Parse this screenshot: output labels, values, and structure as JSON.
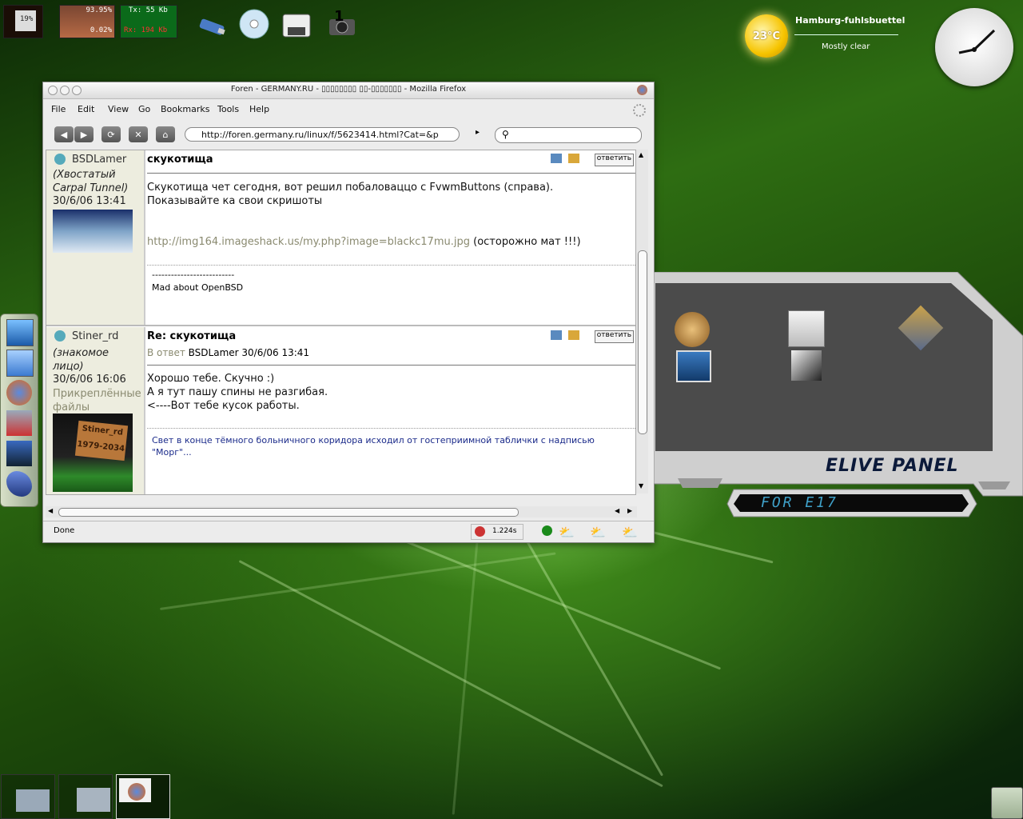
{
  "desktop": {
    "monitors": {
      "cpu_percent": "19%",
      "mem_top": "93.95%",
      "mem_bottom": "0.02%",
      "net_tx": "Tx: 55 Kb",
      "net_rx": "Rx: 194 Kb"
    },
    "icons": [
      "usb-drive-icon",
      "cd-icon",
      "floppy-icon",
      "camera-icon"
    ],
    "camera_badge": "1",
    "weather": {
      "temp": "23°C",
      "city": "Hamburg-fuhlsbuettel",
      "condition": "Mostly clear"
    }
  },
  "browser": {
    "title": "Foren - GERMANY.RU - ▯▯▯▯▯▯▯▯ ▯▯-▯▯▯▯▯▯▯ - Mozilla Firefox",
    "menu": [
      "File",
      "Edit",
      "View",
      "Go",
      "Bookmarks",
      "Tools",
      "Help"
    ],
    "url": "http://foren.germany.ru/linux/f/5623414.html?Cat=&p",
    "search_placeholder": "",
    "status": "Done",
    "load_time": "1.224s",
    "reply_label": "ответить",
    "posts": [
      {
        "author": "BSDLamer",
        "status": "(Хвостатый Carpal Tunnel)",
        "date": "30/6/06 13:41",
        "subject": "скукотища",
        "body": [
          "Скукотища чет сегодня, вот решил побаловаццо с FvwmButtons (справа).",
          "Показывайте ка свои скришоты"
        ],
        "link": "http://img164.imageshack.us/my.php?image=blackc17mu.jpg",
        "link_suffix": "(осторожно мат !!!)",
        "signature_rule": "--------------------------",
        "signature": "Mad about OpenBSD"
      },
      {
        "author": "Stiner_rd",
        "status": "(знакомое лицо)",
        "date": "30/6/06 16:06",
        "attachments": "Прикреплённые файлы",
        "subject": "Re: скукотища",
        "in_reply_prefix": "В ответ",
        "in_reply_rest": "BSDLamer 30/6/06 13:41",
        "body": [
          "Хорошо тебе. Скучно :)",
          "А я тут пашу спины не разгибая.",
          "<----Вот тебе кусок работы."
        ],
        "signature": "Свет в конце тёмного больничного коридора исходил от гостеприимной таблички с надписью \"Морг\"...",
        "avatar_text_1": "Stiner_rd",
        "avatar_text_2": "1979-2034"
      }
    ]
  },
  "elive_panel": {
    "title": "ELIVE PANEL",
    "subtitle": "FOR E17"
  },
  "colors": {
    "link": "#8a8a70",
    "signature": "#1a2a8a",
    "panel_text": "#3fa0c8"
  }
}
